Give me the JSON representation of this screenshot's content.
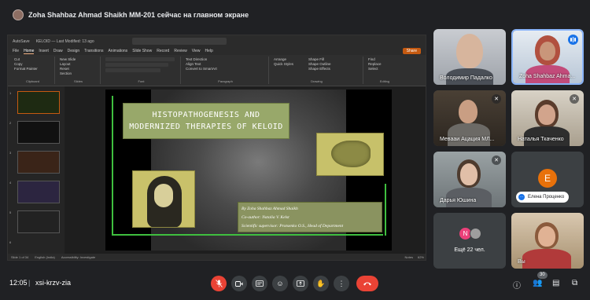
{
  "presenter_bar": {
    "text": "Zoha Shahbaz Ahmad Shaikh MM-201 сейчас на главном экране"
  },
  "powerpoint": {
    "title_left": "AutoSave",
    "title_doc": "KELOID — Last Modified: 13 ago",
    "search_placeholder": "Search",
    "menu": [
      "File",
      "Home",
      "Insert",
      "Draw",
      "Design",
      "Transitions",
      "Animations",
      "Slide Show",
      "Record",
      "Review",
      "View",
      "Help"
    ],
    "active_menu": "Home",
    "share_label": "Share",
    "ribbon_groups": [
      {
        "label": "Clipboard",
        "items": [
          "Cut",
          "Copy",
          "Format Painter"
        ]
      },
      {
        "label": "Slides",
        "items": [
          "New Slide",
          "Layout",
          "Reset",
          "Section"
        ]
      },
      {
        "label": "Font",
        "items": []
      },
      {
        "label": "Paragraph",
        "items": [
          "Text Direction",
          "Align Text",
          "Convert to SmartArt"
        ]
      },
      {
        "label": "Drawing",
        "items": [
          "Shape Fill",
          "Shape Outline",
          "Shape Effects"
        ]
      },
      {
        "label": "Editing",
        "items": [
          "Find",
          "Replace",
          "Select"
        ]
      }
    ],
    "arrange_label": "Arrange",
    "quick_styles_label": "Quick Styles",
    "thumbnails": [
      "1",
      "2",
      "3",
      "4",
      "5",
      "6"
    ],
    "status_left": "Slide 1 of 34",
    "status_lang": "English (India)",
    "status_access": "Accessibility: Investigate",
    "status_notes": "Notes",
    "status_zoom": "62%"
  },
  "slide": {
    "title_line1": "HISTOPATHOGENESIS AND",
    "title_line2": "MODERNIZED THERAPIES OF KELOID",
    "author": "By Zoha Shahbaz Ahmad Shaikh",
    "coauthor": "Co-author: Natalia V. Kelst",
    "supervisor": "Scientific supervisor: Protsenko O.S., Head of Department"
  },
  "participants": [
    {
      "name": "Володимир Падалко",
      "mic_off": false
    },
    {
      "name": "Zoha Shahbaz Ahma...",
      "speaking": true
    },
    {
      "name": "Мевааи Ацация МЛ...",
      "mic_off": true
    },
    {
      "name": "Наталья Ткаченко",
      "mic_off": true
    },
    {
      "name": "Дарья Юшина",
      "mic_off": true
    },
    {
      "name": "Елена Проценко",
      "initial": "E"
    },
    {
      "name": "Ещё 22 чел.",
      "initial": "N"
    },
    {
      "name": "Вы"
    }
  ],
  "bottom_bar": {
    "time": "12:05",
    "separator": "|",
    "meeting_code": "xsi-krzv-zia",
    "participant_count": "30"
  },
  "colors": {
    "meet_bg": "#202124",
    "hangup_red": "#ea4335",
    "slide_green": "#3fbf3f",
    "title_box": "#98a86a",
    "speaking_blue": "#1a73e8"
  }
}
